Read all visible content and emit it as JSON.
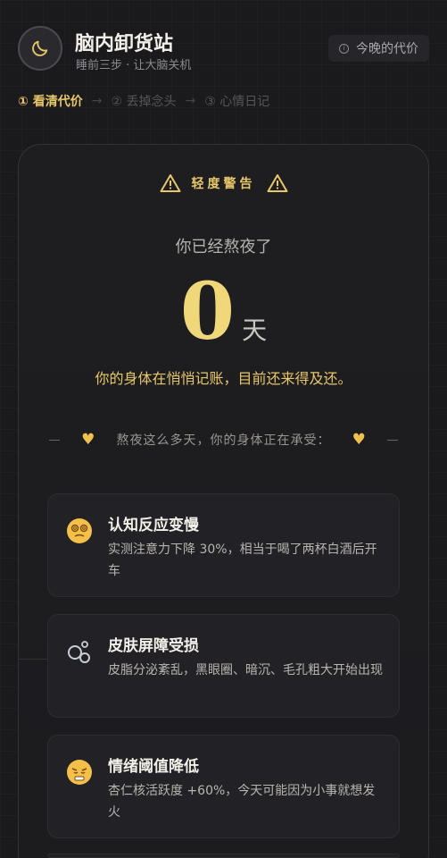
{
  "header": {
    "title": "脑内卸货站",
    "subtitle": "睡前三步 · 让大脑关机",
    "cost_button": "今晚的代价"
  },
  "steps": [
    {
      "label": "① 看清代价",
      "active": true
    },
    {
      "label": "② 丢掉念头",
      "active": false
    },
    {
      "label": "③ 心情日记",
      "active": false
    }
  ],
  "step_arrow": "→",
  "card": {
    "warning": "轻度警告",
    "stayed_label": "你已经熬夜了",
    "days_value": "0",
    "days_unit": "天",
    "body_note": "你的身体在悄悄记账，目前还来得及还。",
    "divider_text": "熬夜这么多天，你的身体正在承受：",
    "items": [
      {
        "icon": "dizzy-face-icon",
        "title": "认知反应变慢",
        "desc": "实测注意力下降 30%，相当于喝了两杯白酒后开车"
      },
      {
        "icon": "bubbles-icon",
        "title": "皮肤屏障受损",
        "desc": "皮脂分泌紊乱，黑眼圈、暗沉、毛孔粗大开始出现"
      },
      {
        "icon": "steaming-face-icon",
        "title": "情绪阈值降低",
        "desc": "杏仁核活跃度 +60%，今天可能因为小事就想发火"
      }
    ]
  },
  "colors": {
    "accent": "#e8c66a",
    "background": "#1a1a1d"
  }
}
